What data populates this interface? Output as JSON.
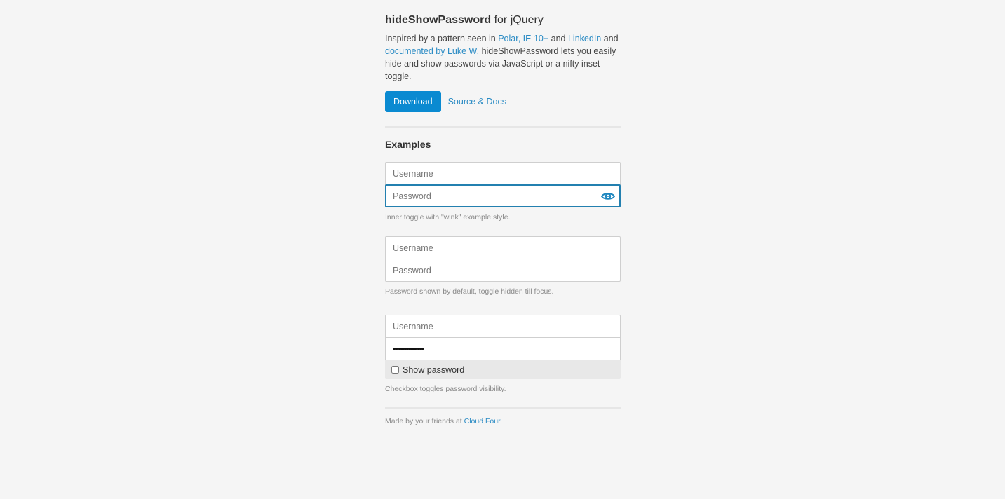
{
  "header": {
    "title_bold": "hideShowPassword",
    "title_rest": " for jQuery"
  },
  "intro": {
    "text1": "Inspired by a pattern seen in ",
    "link_polar": "Polar,",
    "sep1": " ",
    "link_ie": "IE 10+",
    "text2": " and ",
    "link_linkedin": "LinkedIn",
    "text3": " and ",
    "link_lukew": "documented by Luke W,",
    "text4": " hideShowPassword lets you easily hide and show passwords via JavaScript or a nifty inset toggle."
  },
  "actions": {
    "download_label": "Download",
    "source_label": "Source & Docs"
  },
  "examples": {
    "heading": "Examples",
    "example1": {
      "username_placeholder": "Username",
      "password_placeholder": "Password",
      "toggle_icon": "eye-icon",
      "help": "Inner toggle with \"wink\" example style."
    },
    "example2": {
      "username_placeholder": "Username",
      "password_placeholder": "Password",
      "help": "Password shown by default, toggle hidden till focus."
    },
    "example3": {
      "username_placeholder": "Username",
      "password_masked": "••••••••••••••••",
      "show_password_label": "Show password",
      "show_password_checked": false,
      "help": "Checkbox toggles password visibility."
    }
  },
  "footer": {
    "text": "Made by your friends at ",
    "link": "Cloud Four"
  },
  "colors": {
    "accent": "#0a8ad1",
    "link": "#2a8bc4",
    "focus_border": "#2380b0",
    "background": "#f5f5f5"
  }
}
